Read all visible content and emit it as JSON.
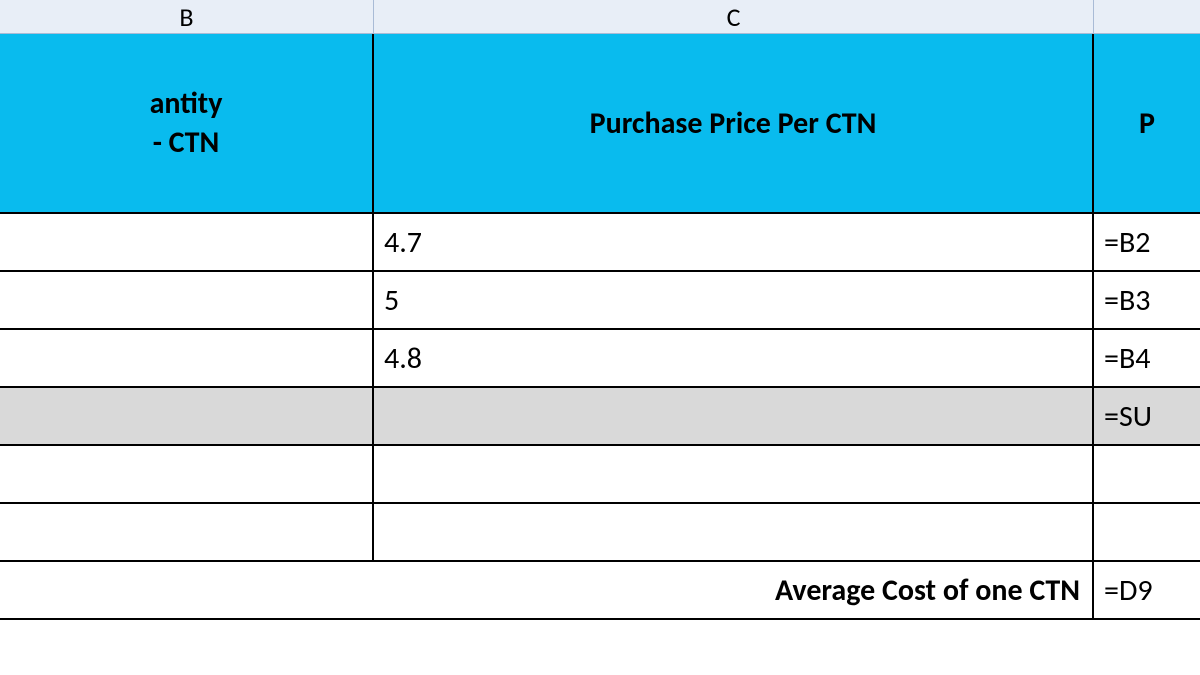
{
  "columns": {
    "b": "B",
    "c": "C"
  },
  "headers": {
    "b_line1": "antity",
    "b_line2": " - CTN",
    "c": "Purchase  Price Per CTN",
    "d": "P"
  },
  "rows": [
    {
      "b": "",
      "c": "4.7",
      "d": "=B2"
    },
    {
      "b": "",
      "c": "5",
      "d": "=B3"
    },
    {
      "b": "",
      "c": "4.8",
      "d": "=B4"
    }
  ],
  "sumRow": {
    "b": "",
    "c": "",
    "d": "=SU"
  },
  "emptyRow1": {
    "b": "",
    "c": "",
    "d": ""
  },
  "emptyRow2": {
    "b": "",
    "c": "",
    "d": ""
  },
  "avgRow": {
    "label": "Average Cost of one CTN",
    "d": "=D9"
  }
}
